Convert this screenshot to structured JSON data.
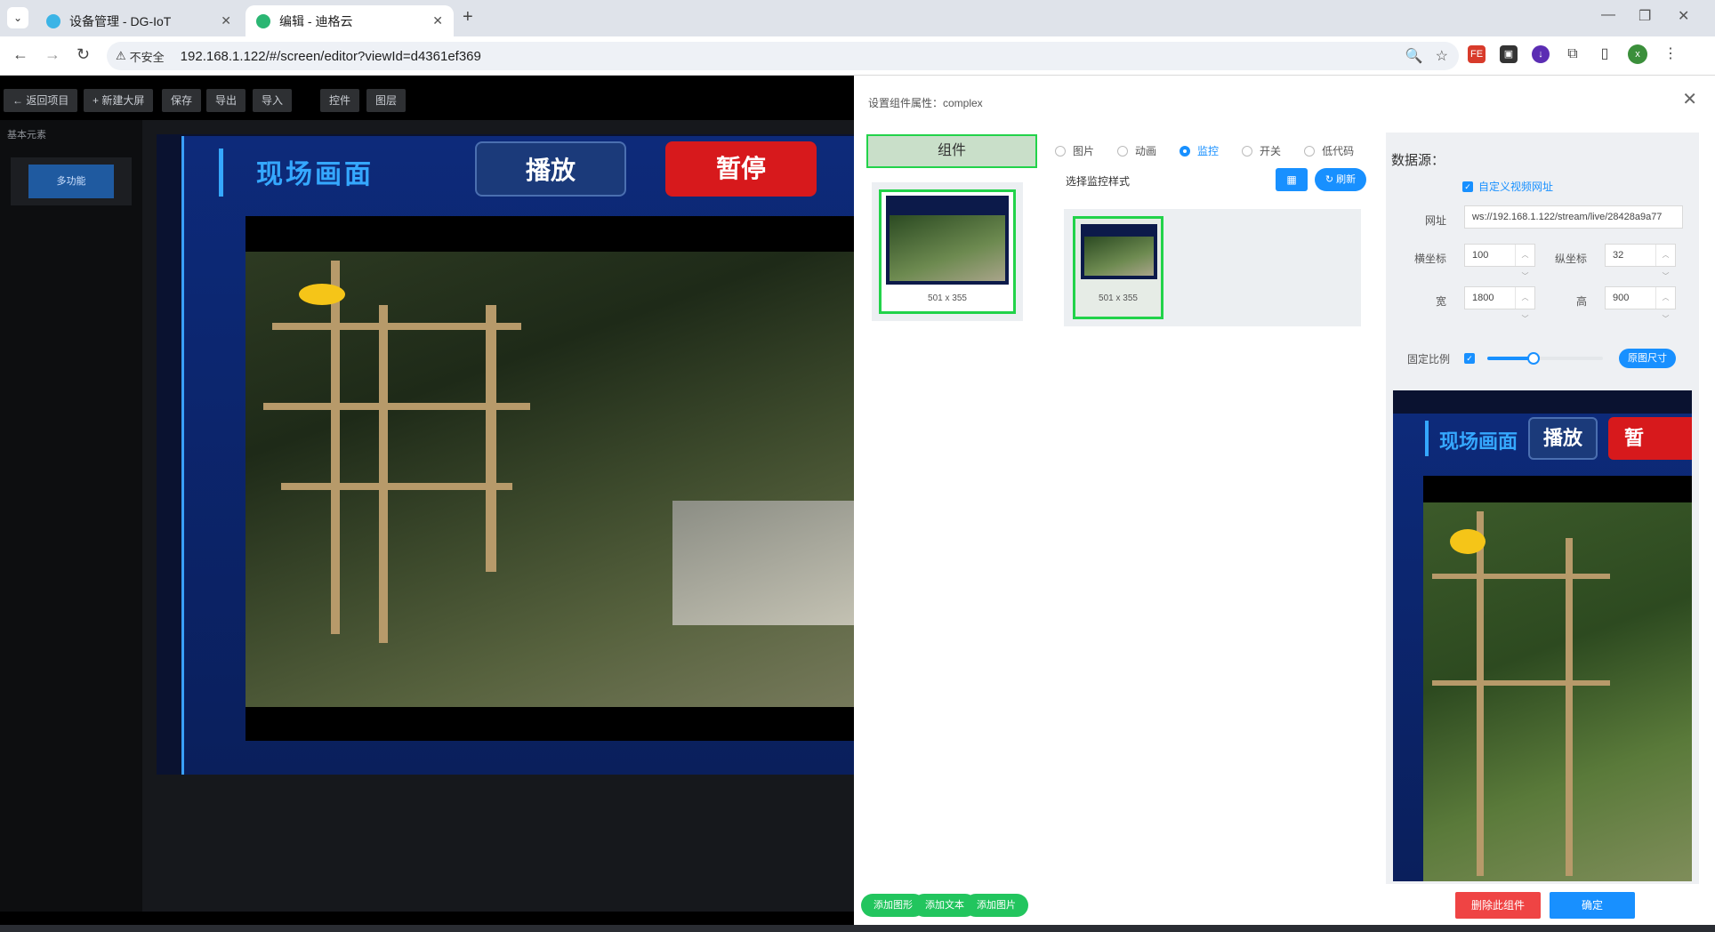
{
  "browser": {
    "tabs": [
      {
        "title": "设备管理 - DG-IoT",
        "active": false
      },
      {
        "title": "编辑 - 迪格云",
        "active": true
      }
    ],
    "security_label": "不安全",
    "url": "192.168.1.122/#/screen/editor?viewId=d4361ef369",
    "profile_initial": "x",
    "ext_fe": "FE"
  },
  "toolbar": {
    "back": "← 返回项目",
    "new_screen": "+ 新建大屏",
    "save": "保存",
    "export": "导出",
    "import": "导入",
    "controls": "控件",
    "layers": "图层"
  },
  "left_panel": {
    "title": "基本元素",
    "item": "多功能"
  },
  "screen": {
    "title": "现场画面",
    "play": "播放",
    "pause": "暂停"
  },
  "drawer": {
    "title": "设置组件属性：complex",
    "component_tab": "组件",
    "thumb_size": "501 x 355",
    "radio_options": [
      {
        "label": "图片",
        "checked": false
      },
      {
        "label": "动画",
        "checked": false
      },
      {
        "label": "监控",
        "checked": true
      },
      {
        "label": "开关",
        "checked": false
      },
      {
        "label": "低代码",
        "checked": false
      }
    ],
    "style_label": "选择监控样式",
    "refresh": "刷新",
    "style_thumb_size": "501 x 355",
    "datasource": {
      "title": "数据源：",
      "custom_url_label": "自定义视频网址",
      "url_label": "网址",
      "url_value": "ws://192.168.1.122/stream/live/28428a9a77",
      "x_label": "横坐标",
      "x_value": "100",
      "y_label": "纵坐标",
      "y_value": "32",
      "w_label": "宽",
      "w_value": "1800",
      "h_label": "高",
      "h_value": "900",
      "ratio_label": "固定比例",
      "slider_level": 0.4,
      "orig_size": "原图尺寸"
    },
    "preview": {
      "title": "现场画面",
      "play": "播放",
      "pause": "暂"
    },
    "footer": {
      "add_shape": "添加图形",
      "add_text": "添加文本",
      "add_image": "添加图片",
      "delete": "删除此组件",
      "confirm": "确定"
    }
  },
  "colors": {
    "accent": "#1890ff",
    "green": "#22c55e",
    "danger": "#ef4444",
    "screen_title": "#35a8ff"
  }
}
